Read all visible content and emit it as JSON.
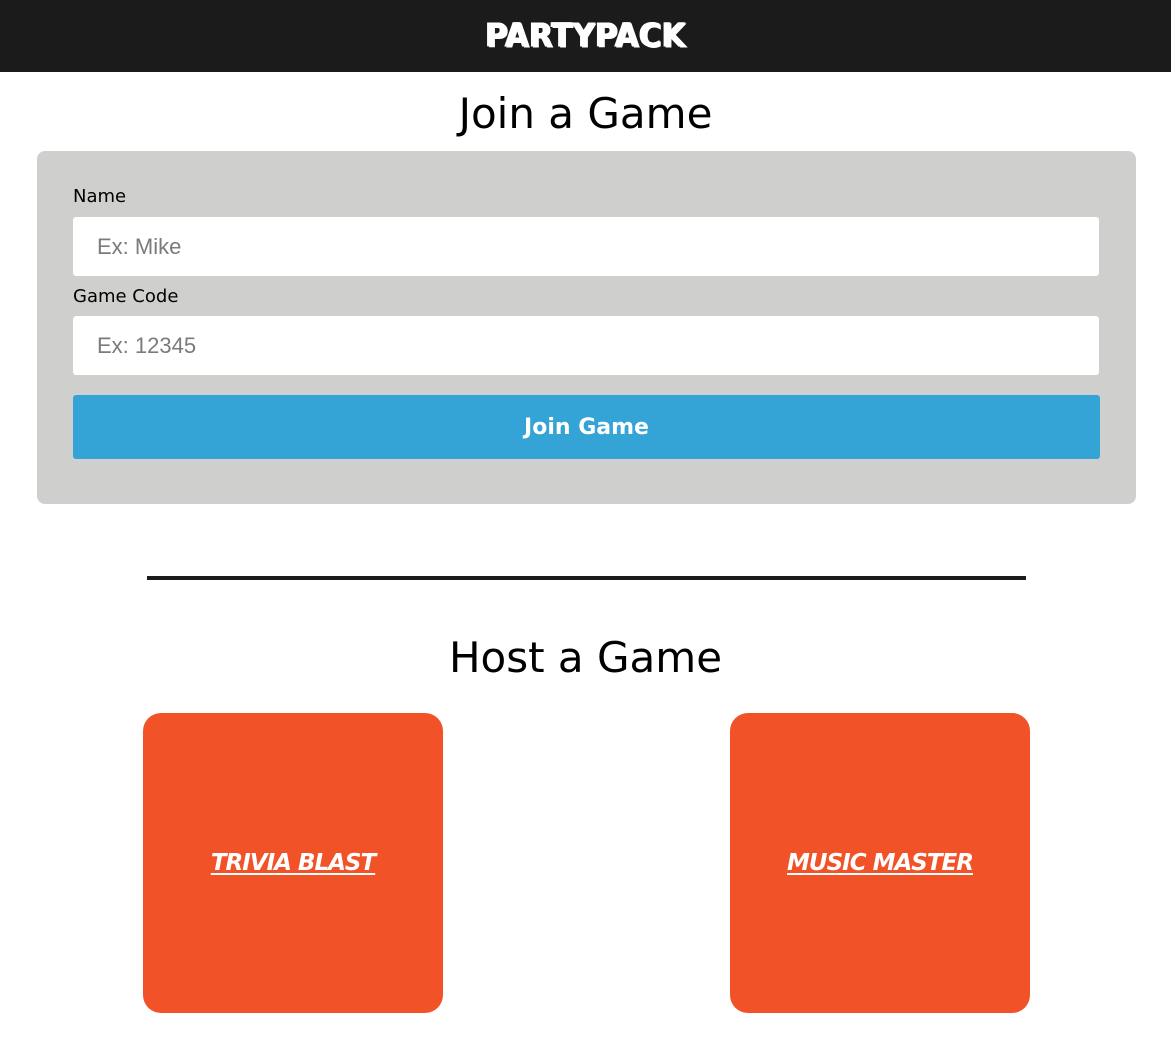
{
  "header": {
    "logo_text": "PARTYPACK"
  },
  "join": {
    "title": "Join a Game",
    "name_label": "Name",
    "name_placeholder": "Ex: Mike",
    "name_value": "",
    "code_label": "Game Code",
    "code_placeholder": "Ex: 12345",
    "code_value": "",
    "button_label": "Join Game"
  },
  "host": {
    "title": "Host a Game",
    "games": [
      {
        "label": "TRIVIA BLAST"
      },
      {
        "label": "MUSIC MASTER"
      }
    ]
  },
  "colors": {
    "header_bg": "#1b1b1b",
    "panel_bg": "#cfd0ce",
    "button_bg": "#34a3d5",
    "card_bg": "#f25227"
  }
}
